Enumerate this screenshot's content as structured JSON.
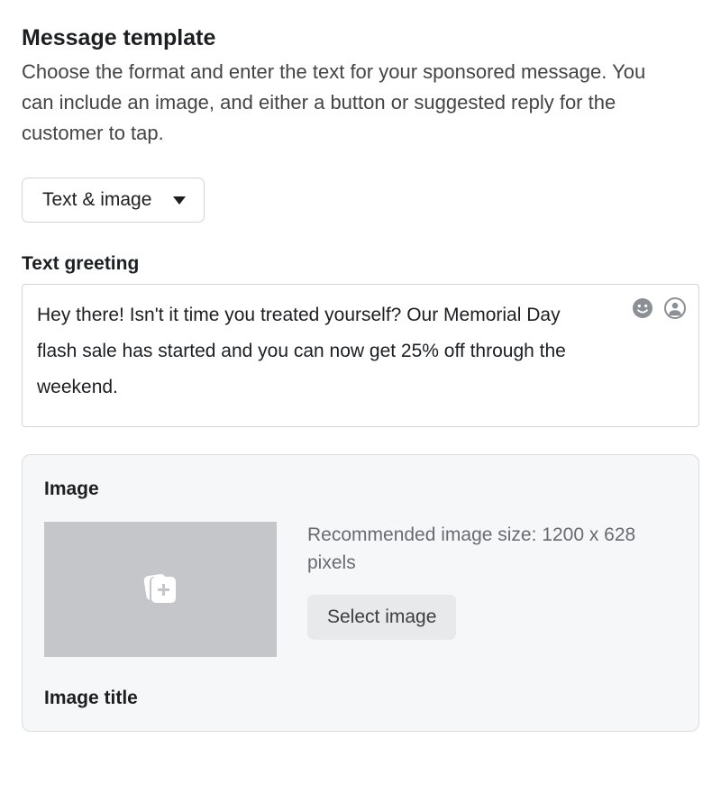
{
  "header": {
    "title": "Message template",
    "description": "Choose the format and enter the text for your sponsored message. You can include an image, and either a button or suggested reply for the customer to tap."
  },
  "format_dropdown": {
    "selected": "Text & image"
  },
  "greeting": {
    "label": "Text greeting",
    "value": "Hey there! Isn't it time you treated yourself? Our Memorial Day flash sale has started and you can now get 25% off through the weekend."
  },
  "image_section": {
    "label": "Image",
    "hint": "Recommended image size: 1200 x 628 pixels",
    "select_button": "Select image",
    "title_label": "Image title"
  },
  "icons": {
    "emoji": "emoji-icon",
    "person": "person-icon",
    "add_image": "add-image-icon"
  }
}
